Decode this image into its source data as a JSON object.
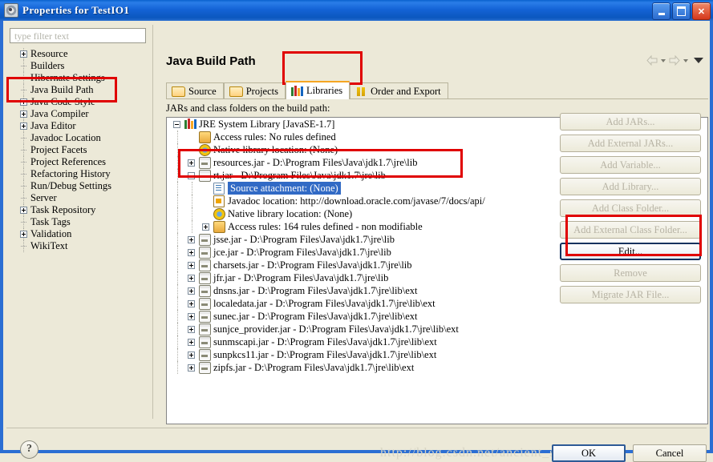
{
  "window": {
    "title": "Properties for TestIO1",
    "icon": "properties-icon",
    "minimize_label": "Minimize",
    "maximize_label": "Maximize",
    "close_label": "✕",
    "accent_titlebar": "#1463D6",
    "dialog_bg": "#ECE9D8"
  },
  "filter": {
    "placeholder": "type filter text",
    "value": ""
  },
  "sidebar": {
    "items": [
      {
        "label": "Resource",
        "expandable": true,
        "selected": false
      },
      {
        "label": "Builders",
        "expandable": false,
        "selected": false
      },
      {
        "label": "Hibernate Settings",
        "expandable": false,
        "selected": false
      },
      {
        "label": "Java Build Path",
        "expandable": false,
        "selected": true
      },
      {
        "label": "Java Code Style",
        "expandable": true,
        "selected": false
      },
      {
        "label": "Java Compiler",
        "expandable": true,
        "selected": false
      },
      {
        "label": "Java Editor",
        "expandable": true,
        "selected": false
      },
      {
        "label": "Javadoc Location",
        "expandable": false,
        "selected": false
      },
      {
        "label": "Project Facets",
        "expandable": false,
        "selected": false
      },
      {
        "label": "Project References",
        "expandable": false,
        "selected": false
      },
      {
        "label": "Refactoring History",
        "expandable": false,
        "selected": false
      },
      {
        "label": "Run/Debug Settings",
        "expandable": false,
        "selected": false
      },
      {
        "label": "Server",
        "expandable": false,
        "selected": false
      },
      {
        "label": "Task Repository",
        "expandable": true,
        "selected": false
      },
      {
        "label": "Task Tags",
        "expandable": false,
        "selected": false
      },
      {
        "label": "Validation",
        "expandable": true,
        "selected": false
      },
      {
        "label": "WikiText",
        "expandable": false,
        "selected": false
      }
    ]
  },
  "main": {
    "page_title": "Java Build Path",
    "subtitle": "JARs and class folders on the build path:",
    "nav": {
      "back_label": "Back",
      "forward_label": "Forward",
      "menu_label": "Menu"
    },
    "tabs": [
      {
        "label": "Source",
        "icon": "source-folder-icon",
        "active": false
      },
      {
        "label": "Projects",
        "icon": "projects-folder-icon",
        "active": false
      },
      {
        "label": "Libraries",
        "icon": "libraries-books-icon",
        "active": true
      },
      {
        "label": "Order and Export",
        "icon": "order-export-icon",
        "active": false
      }
    ]
  },
  "tree": {
    "rows": [
      {
        "indent": 0,
        "expander": "minus",
        "icon": "libraries-books-icon",
        "label": "JRE System Library [JavaSE-1.7]",
        "selected": false
      },
      {
        "indent": 1,
        "expander": "none",
        "icon": "access-rules-icon",
        "label": "Access rules: No rules defined",
        "selected": false
      },
      {
        "indent": 1,
        "expander": "none",
        "icon": "native-library-icon",
        "label": "Native library location: (None)",
        "selected": false
      },
      {
        "indent": 1,
        "expander": "plus",
        "icon": "jar-icon",
        "label": "resources.jar - D:\\Program Files\\Java\\jdk1.7\\jre\\lib",
        "selected": false
      },
      {
        "indent": 1,
        "expander": "minus",
        "icon": "jar-icon",
        "label": "rt.jar - D:\\Program Files\\Java\\jdk1.7\\jre\\lib",
        "selected": false
      },
      {
        "indent": 2,
        "expander": "none",
        "icon": "source-attachment-icon",
        "label": "Source attachment: (None)",
        "selected": true
      },
      {
        "indent": 2,
        "expander": "none",
        "icon": "javadoc-icon",
        "label": "Javadoc location: http://download.oracle.com/javase/7/docs/api/",
        "selected": false
      },
      {
        "indent": 2,
        "expander": "none",
        "icon": "native-library-icon",
        "label": "Native library location: (None)",
        "selected": false
      },
      {
        "indent": 2,
        "expander": "plus",
        "icon": "access-rules-icon",
        "label": "Access rules: 164 rules defined - non modifiable",
        "selected": false
      },
      {
        "indent": 1,
        "expander": "plus",
        "icon": "jar-icon",
        "label": "jsse.jar - D:\\Program Files\\Java\\jdk1.7\\jre\\lib",
        "selected": false
      },
      {
        "indent": 1,
        "expander": "plus",
        "icon": "jar-icon",
        "label": "jce.jar - D:\\Program Files\\Java\\jdk1.7\\jre\\lib",
        "selected": false
      },
      {
        "indent": 1,
        "expander": "plus",
        "icon": "jar-icon",
        "label": "charsets.jar - D:\\Program Files\\Java\\jdk1.7\\jre\\lib",
        "selected": false
      },
      {
        "indent": 1,
        "expander": "plus",
        "icon": "jar-icon",
        "label": "jfr.jar - D:\\Program Files\\Java\\jdk1.7\\jre\\lib",
        "selected": false
      },
      {
        "indent": 1,
        "expander": "plus",
        "icon": "jar-icon",
        "label": "dnsns.jar - D:\\Program Files\\Java\\jdk1.7\\jre\\lib\\ext",
        "selected": false
      },
      {
        "indent": 1,
        "expander": "plus",
        "icon": "jar-icon",
        "label": "localedata.jar - D:\\Program Files\\Java\\jdk1.7\\jre\\lib\\ext",
        "selected": false
      },
      {
        "indent": 1,
        "expander": "plus",
        "icon": "jar-icon",
        "label": "sunec.jar - D:\\Program Files\\Java\\jdk1.7\\jre\\lib\\ext",
        "selected": false
      },
      {
        "indent": 1,
        "expander": "plus",
        "icon": "jar-icon",
        "label": "sunjce_provider.jar - D:\\Program Files\\Java\\jdk1.7\\jre\\lib\\ext",
        "selected": false
      },
      {
        "indent": 1,
        "expander": "plus",
        "icon": "jar-icon",
        "label": "sunmscapi.jar - D:\\Program Files\\Java\\jdk1.7\\jre\\lib\\ext",
        "selected": false
      },
      {
        "indent": 1,
        "expander": "plus",
        "icon": "jar-icon",
        "label": "sunpkcs11.jar - D:\\Program Files\\Java\\jdk1.7\\jre\\lib\\ext",
        "selected": false
      },
      {
        "indent": 1,
        "expander": "plus",
        "icon": "jar-icon",
        "label": "zipfs.jar - D:\\Program Files\\Java\\jdk1.7\\jre\\lib\\ext",
        "selected": false
      }
    ]
  },
  "buttons": [
    {
      "label": "Add JARs...",
      "enabled": false,
      "name": "add-jars-button"
    },
    {
      "label": "Add External JARs...",
      "enabled": false,
      "name": "add-external-jars-button"
    },
    {
      "label": "Add Variable...",
      "enabled": false,
      "name": "add-variable-button"
    },
    {
      "label": "Add Library...",
      "enabled": false,
      "name": "add-library-button"
    },
    {
      "label": "Add Class Folder...",
      "enabled": false,
      "name": "add-class-folder-button"
    },
    {
      "label": "Add External Class Folder...",
      "enabled": false,
      "name": "add-external-class-folder-button"
    },
    {
      "label": "Edit...",
      "enabled": true,
      "name": "edit-button"
    },
    {
      "label": "Remove",
      "enabled": false,
      "name": "remove-button"
    },
    {
      "label": "Migrate JAR File...",
      "enabled": false,
      "name": "migrate-jar-file-button"
    }
  ],
  "footer": {
    "help_label": "?",
    "ok_label": "OK",
    "cancel_label": "Cancel"
  },
  "watermark": {
    "text": "http://blog.csdn.net/ancient_spy_history"
  },
  "highlights": {
    "color": "#E00000",
    "regions": [
      "sidebar-java-build-path",
      "libraries-tab",
      "source-attachment-row",
      "edit-button"
    ]
  }
}
